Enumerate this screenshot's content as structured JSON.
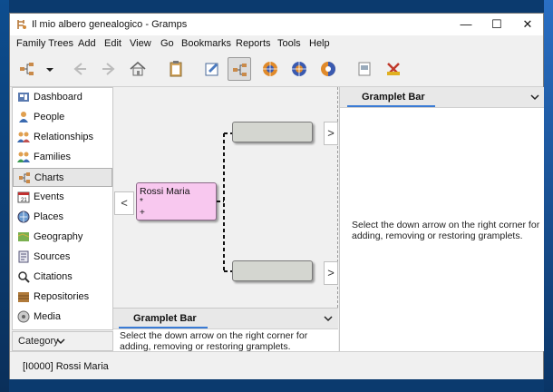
{
  "window": {
    "title": "Il mio albero genealogico - Gramps",
    "minimize": "—",
    "maximize": "☐",
    "close": "✕"
  },
  "menu": [
    "Family Trees",
    "Add",
    "Edit",
    "View",
    "Go",
    "Bookmarks",
    "Reports",
    "Tools",
    "Help"
  ],
  "toolbar": {
    "icons": [
      "tree-view-icon",
      "dropdown-icon",
      "back-icon",
      "forward-icon",
      "home-icon",
      "clipboard-icon",
      "edit-icon",
      "pedigree-icon",
      "fan-chart-icon",
      "descendant-fan-icon",
      "fan-2way-icon",
      "report-icon",
      "tools-icon"
    ]
  },
  "sidebar": {
    "items": [
      {
        "label": "Dashboard",
        "icon": "dashboard-icon"
      },
      {
        "label": "People",
        "icon": "people-icon"
      },
      {
        "label": "Relationships",
        "icon": "relationships-icon"
      },
      {
        "label": "Families",
        "icon": "families-icon"
      },
      {
        "label": "Charts",
        "icon": "charts-icon",
        "active": true
      },
      {
        "label": "Events",
        "icon": "events-icon"
      },
      {
        "label": "Places",
        "icon": "places-icon"
      },
      {
        "label": "Geography",
        "icon": "geography-icon"
      },
      {
        "label": "Sources",
        "icon": "sources-icon"
      },
      {
        "label": "Citations",
        "icon": "citations-icon"
      },
      {
        "label": "Repositories",
        "icon": "repositories-icon"
      },
      {
        "label": "Media",
        "icon": "media-icon"
      }
    ],
    "category_label": "Category"
  },
  "chart": {
    "person": {
      "name": "Rossi Maria",
      "birth": "*",
      "death": "+"
    },
    "left_arrow": "<",
    "right_arrow": ">"
  },
  "bottom_gramplet": {
    "tab": "Gramplet Bar",
    "text": "Select the down arrow on the right corner for adding, removing or restoring gramplets."
  },
  "right_gramplet": {
    "tab": "Gramplet Bar",
    "text": "Select the down arrow on the right corner for adding, removing or restoring gramplets."
  },
  "status": {
    "text": "[I0000] Rossi Maria"
  },
  "colors": {
    "person_female": "#f8c8ef",
    "empty_person": "#d4d6d0",
    "accent": "#3a7bd5"
  }
}
